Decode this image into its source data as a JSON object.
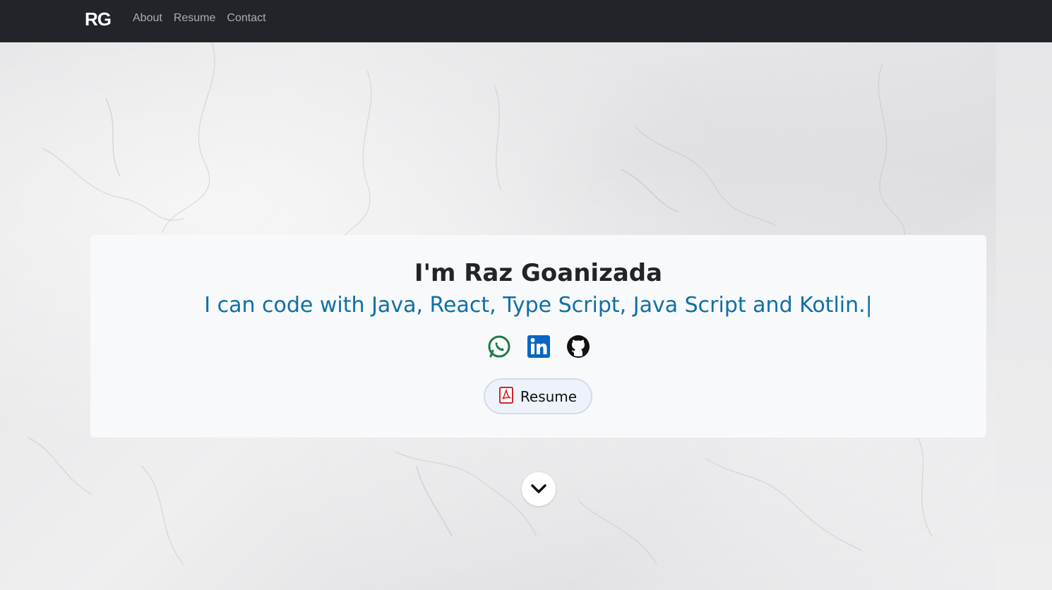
{
  "nav": {
    "brand": "RG",
    "links": [
      "About",
      "Resume",
      "Contact"
    ]
  },
  "hero": {
    "title": "I'm Raz Goanizada",
    "subtitle": "I can code with Java, React, Type Script, Java Script and Kotlin.|",
    "social_icons": [
      "whatsapp-icon",
      "linkedin-icon",
      "github-icon"
    ],
    "resume_button": "Resume",
    "scroll_icon": "chevron-down-icon"
  },
  "colors": {
    "navbar_bg": "#212529",
    "subtitle": "#0f6fa6",
    "whatsapp": "#1f7a46",
    "linkedin": "#0a66c2",
    "github": "#111111",
    "pdf_icon": "#d1242f"
  }
}
